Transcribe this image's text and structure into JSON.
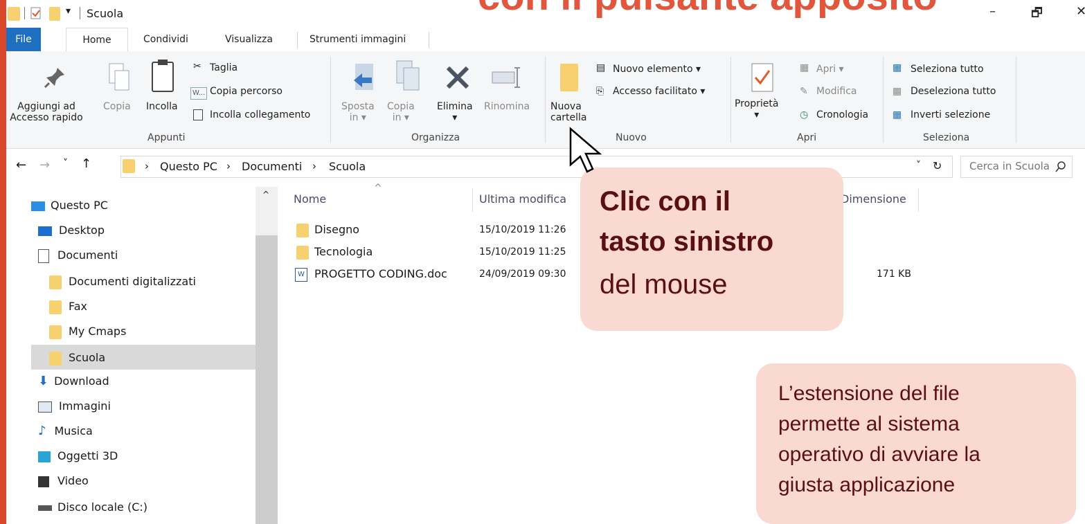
{
  "slide": {
    "title_fragment": "con il pulsante apposito"
  },
  "window": {
    "title": "Scuola",
    "min": "–",
    "max": "🗗",
    "close": "✕"
  },
  "tabs": [
    {
      "label": "File"
    },
    {
      "label": "Home"
    },
    {
      "label": "Condividi"
    },
    {
      "label": "Visualizza"
    },
    {
      "label": "Strumenti immagini"
    }
  ],
  "ribbon": {
    "appunti": {
      "pin": "Aggiungi ad\nAccesso rapido",
      "copy": "Copia",
      "paste": "Incolla",
      "cut": "Taglia",
      "copy_path": "Copia percorso",
      "paste_link": "Incolla collegamento",
      "group": "Appunti"
    },
    "organizza": {
      "move": "Sposta\nin ▾",
      "copy_to": "Copia\nin ▾",
      "delete": "Elimina\n▾",
      "rename": "Rinomina",
      "group": "Organizza"
    },
    "nuovo": {
      "new_folder": "Nuova\ncartella",
      "new_item": "Nuovo elemento ▾",
      "easy_access": "Accesso facilitato ▾",
      "group": "Nuovo"
    },
    "apri": {
      "properties": "Proprietà\n▾",
      "open": "Apri ▾",
      "edit": "Modifica",
      "history": "Cronologia",
      "group": "Apri"
    },
    "seleziona": {
      "select_all": "Seleziona tutto",
      "deselect_all": "Deseleziona tutto",
      "invert": "Inverti selezione",
      "group": "Seleziona"
    }
  },
  "address": {
    "back": "←",
    "forward": "→",
    "recent": "˅",
    "up": "↑",
    "crumbs": [
      "Questo PC",
      "Documenti",
      "Scuola"
    ],
    "sep": "›",
    "dropdown": "˅",
    "refresh": "↻",
    "search_placeholder": "Cerca in Scuola"
  },
  "nav": [
    {
      "label": "Questo PC"
    },
    {
      "label": "Desktop"
    },
    {
      "label": "Documenti"
    },
    {
      "label": "Documenti digitalizzati"
    },
    {
      "label": "Fax"
    },
    {
      "label": "My Cmaps"
    },
    {
      "label": "Scuola"
    },
    {
      "label": "Download"
    },
    {
      "label": "Immagini"
    },
    {
      "label": "Musica"
    },
    {
      "label": "Oggetti 3D"
    },
    {
      "label": "Video"
    },
    {
      "label": "Disco locale (C:)"
    }
  ],
  "columns": {
    "name": "Nome",
    "modified": "Ultima modifica",
    "size": "Dimensione",
    "sort": "^"
  },
  "files": [
    {
      "name": "Disegno",
      "modified": "15/10/2019 11:26",
      "size": ""
    },
    {
      "name": "Tecnologia",
      "modified": "15/10/2019 11:25",
      "size": ""
    },
    {
      "name": "PROGETTO CODING.doc",
      "modified": "24/09/2019 09:30",
      "size": "171 KB"
    }
  ],
  "callouts": {
    "click_bold": "Clic con il\ntasto sinistro",
    "click_rest": "del mouse",
    "extension": "L’estensione del file\npermette al sistema\noperativo di avviare la\ngiusta applicazione"
  },
  "colors": {
    "accent": "#1f6fc1",
    "slide_red": "#d9482b",
    "callout_bg": "#fbd9d3",
    "folder": "#f7d170"
  }
}
